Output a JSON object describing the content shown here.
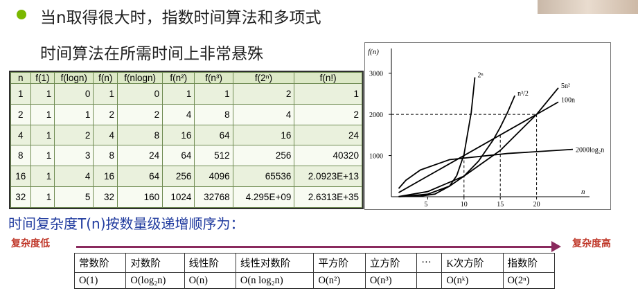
{
  "slide": {
    "line1": "当n取得很大时，指数时间算法和多项式",
    "line2": "时间算法在所需时间上非常悬殊",
    "bottom_title": "时间复杂度T(n)按数量级递增顺序为：",
    "low_label": "复杂度低",
    "high_label": "复杂度高"
  },
  "growth_table": {
    "headers": [
      "n",
      "f(1)",
      "f(logn)",
      "f(n)",
      "f(nlogn)",
      "f(n²)",
      "f(n³)",
      "f(2ⁿ)",
      "f(n!)"
    ],
    "rows": [
      [
        "1",
        "1",
        "0",
        "1",
        "0",
        "1",
        "1",
        "2",
        "1"
      ],
      [
        "2",
        "1",
        "1",
        "2",
        "2",
        "4",
        "8",
        "4",
        "2"
      ],
      [
        "4",
        "1",
        "2",
        "4",
        "8",
        "16",
        "64",
        "16",
        "24"
      ],
      [
        "8",
        "1",
        "3",
        "8",
        "24",
        "64",
        "512",
        "256",
        "40320"
      ],
      [
        "16",
        "1",
        "4",
        "16",
        "64",
        "256",
        "4096",
        "65536",
        "2.0923E+13"
      ],
      [
        "32",
        "1",
        "5",
        "32",
        "160",
        "1024",
        "32768",
        "4.295E+09",
        "2.6313E+35"
      ]
    ]
  },
  "chart_data": {
    "type": "line",
    "ylabel": "f(n)",
    "xlabel": "n",
    "xticks": [
      "5",
      "10",
      "15",
      "20"
    ],
    "yticks": [
      "1000",
      "2000",
      "3000"
    ],
    "xlim": [
      0,
      25
    ],
    "ylim": [
      0,
      3600
    ],
    "series": [
      {
        "name": "2ⁿ",
        "x": [
          1,
          4,
          6,
          8,
          9,
          10,
          11,
          11.5
        ],
        "y": [
          2,
          16,
          64,
          256,
          512,
          1024,
          2048,
          2900
        ]
      },
      {
        "name": "n³/2",
        "x": [
          1,
          5,
          8,
          10,
          12,
          14,
          15,
          16,
          17
        ],
        "y": [
          0.5,
          62,
          256,
          500,
          864,
          1372,
          1688,
          2048,
          2456
        ]
      },
      {
        "name": "5n²",
        "x": [
          1,
          5,
          10,
          15,
          20,
          23
        ],
        "y": [
          5,
          125,
          500,
          1125,
          2000,
          2645
        ]
      },
      {
        "name": "100n",
        "x": [
          1,
          5,
          10,
          15,
          20,
          23
        ],
        "y": [
          100,
          500,
          1000,
          1500,
          2000,
          2300
        ]
      },
      {
        "name": "2000log₂n",
        "x": [
          1,
          2,
          4,
          8,
          16,
          25
        ],
        "y": [
          200,
          400,
          650,
          900,
          1050,
          1150
        ]
      }
    ],
    "dashed_guides": [
      {
        "x": 10,
        "y": 1000
      },
      {
        "x": 15,
        "y": 1500
      },
      {
        "x": 20,
        "y": 2000
      }
    ]
  },
  "order_table": {
    "names": [
      "常数阶",
      "对数阶",
      "线性阶",
      "线性对数阶",
      "平方阶",
      "立方阶",
      "···",
      "K次方阶",
      "指数阶"
    ],
    "notations": [
      "O(1)",
      "O(log₂n)",
      "O(n)",
      "O(n log₂n)",
      "O(n²)",
      "O(n³)",
      "",
      "O(nᵏ)",
      "O(2ⁿ)"
    ]
  }
}
